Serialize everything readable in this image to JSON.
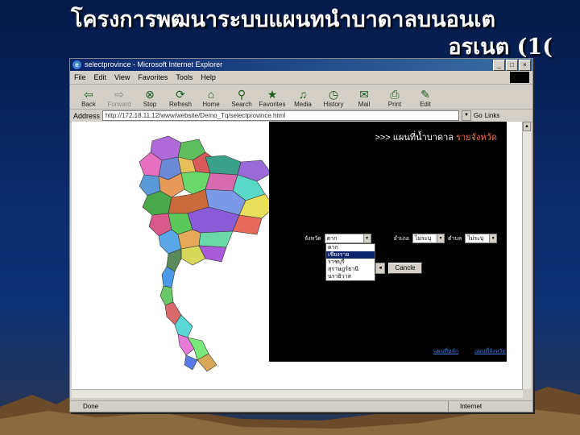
{
  "slide": {
    "title_line1": "โครงการพฒนาระบบแผนทนำบาดาลบนอนเต",
    "title_line2": "อรเนต    (1("
  },
  "browser": {
    "window_title": "selectprovince - Microsoft Internet Explorer",
    "menu": [
      "File",
      "Edit",
      "View",
      "Favorites",
      "Tools",
      "Help"
    ],
    "toolbar": [
      {
        "label": "Back",
        "icon": "back-arrow-icon",
        "glyph": "⇦"
      },
      {
        "label": "Forward",
        "icon": "forward-arrow-icon",
        "glyph": "⇨"
      },
      {
        "label": "Stop",
        "icon": "stop-icon",
        "glyph": "⊗"
      },
      {
        "label": "Refresh",
        "icon": "refresh-icon",
        "glyph": "⟳"
      },
      {
        "label": "Home",
        "icon": "home-icon",
        "glyph": "⌂"
      },
      {
        "label": "Search",
        "icon": "search-icon",
        "glyph": "⚲"
      },
      {
        "label": "Favorites",
        "icon": "favorites-icon",
        "glyph": "★"
      },
      {
        "label": "Media",
        "icon": "media-icon",
        "glyph": "♫"
      },
      {
        "label": "History",
        "icon": "history-icon",
        "glyph": "◷"
      },
      {
        "label": "Mail",
        "icon": "mail-icon",
        "glyph": "✉"
      },
      {
        "label": "Print",
        "icon": "print-icon",
        "glyph": "⎙"
      },
      {
        "label": "Edit",
        "icon": "edit-icon",
        "glyph": "✎"
      }
    ],
    "address_label": "Address",
    "address_value": "http://172.18.11.12/www/website/Demo_Tq/selectprovince.html",
    "go_label": "Go",
    "links_label": "Links",
    "status_left": "Done",
    "status_right": "Internet"
  },
  "panel": {
    "heading_part1": ">>> แผนที่น้ำบาดาล",
    "heading_part2": "รายจังหวัด",
    "province_label": "จังหวัด",
    "province_value": "ตาก",
    "district_label": "อำเภอ",
    "district_value": "ไม่ระบุ",
    "subdistrict_label": "ตำบล",
    "subdistrict_value": "ไม่ระบุ",
    "dropdown_options": [
      "ตาก",
      "เชียงราย",
      "ราชบุรี",
      "สุราษฎร์ธานี",
      "นราธิวาส"
    ],
    "selected_option_index": 1,
    "cancel_label": "Cancle",
    "link1": "แผนที่หลัก",
    "link2": "แผนที่จังหวัด"
  }
}
